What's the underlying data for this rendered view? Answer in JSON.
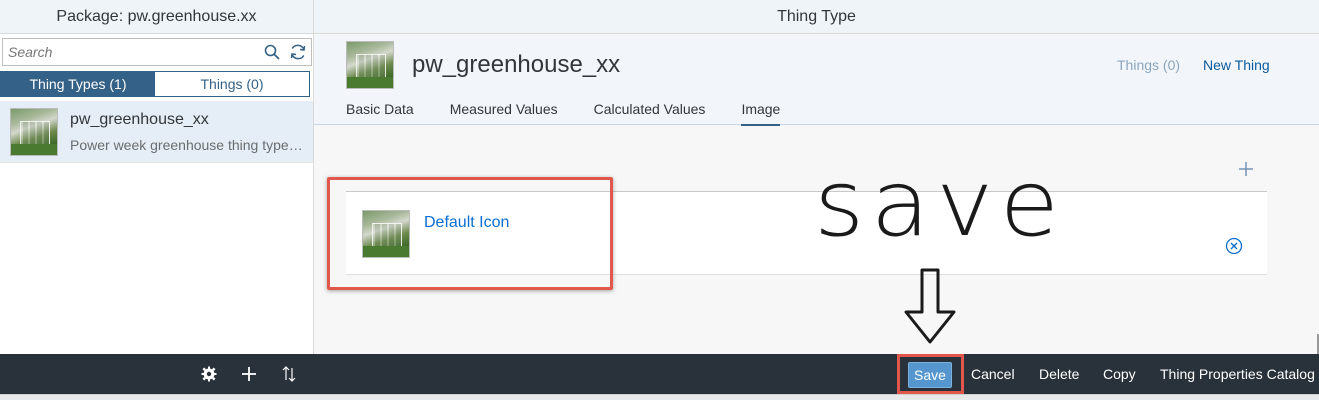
{
  "left": {
    "header": "Package: pw.greenhouse.xx",
    "search_placeholder": "Search",
    "segments": {
      "thing_types": "Thing Types (1)",
      "things": "Things (0)"
    },
    "list": [
      {
        "title": "pw_greenhouse_xx",
        "description": "Power week greenhouse thing type for the Power Week"
      }
    ]
  },
  "right": {
    "header": "Thing Type",
    "object_title": "pw_greenhouse_xx",
    "things_link": "Things (0)",
    "new_thing_link": "New Thing",
    "tabs": [
      "Basic Data",
      "Measured Values",
      "Calculated Values",
      "Image"
    ],
    "active_tab": "Image",
    "image_card_label": "Default Icon",
    "annotation": "save"
  },
  "footer": {
    "save": "Save",
    "cancel": "Cancel",
    "delete": "Delete",
    "copy": "Copy",
    "catalog": "Thing Properties Catalog"
  },
  "colors": {
    "brand": "#346187",
    "link": "#0a6ed1",
    "footer_bg": "#29313a",
    "highlight": "#e2574c",
    "save_button": "#5496cd"
  },
  "icons": [
    "search-icon",
    "refresh-icon",
    "settings-icon",
    "add-icon",
    "sort-icon",
    "remove-icon",
    "down-arrow-icon"
  ]
}
